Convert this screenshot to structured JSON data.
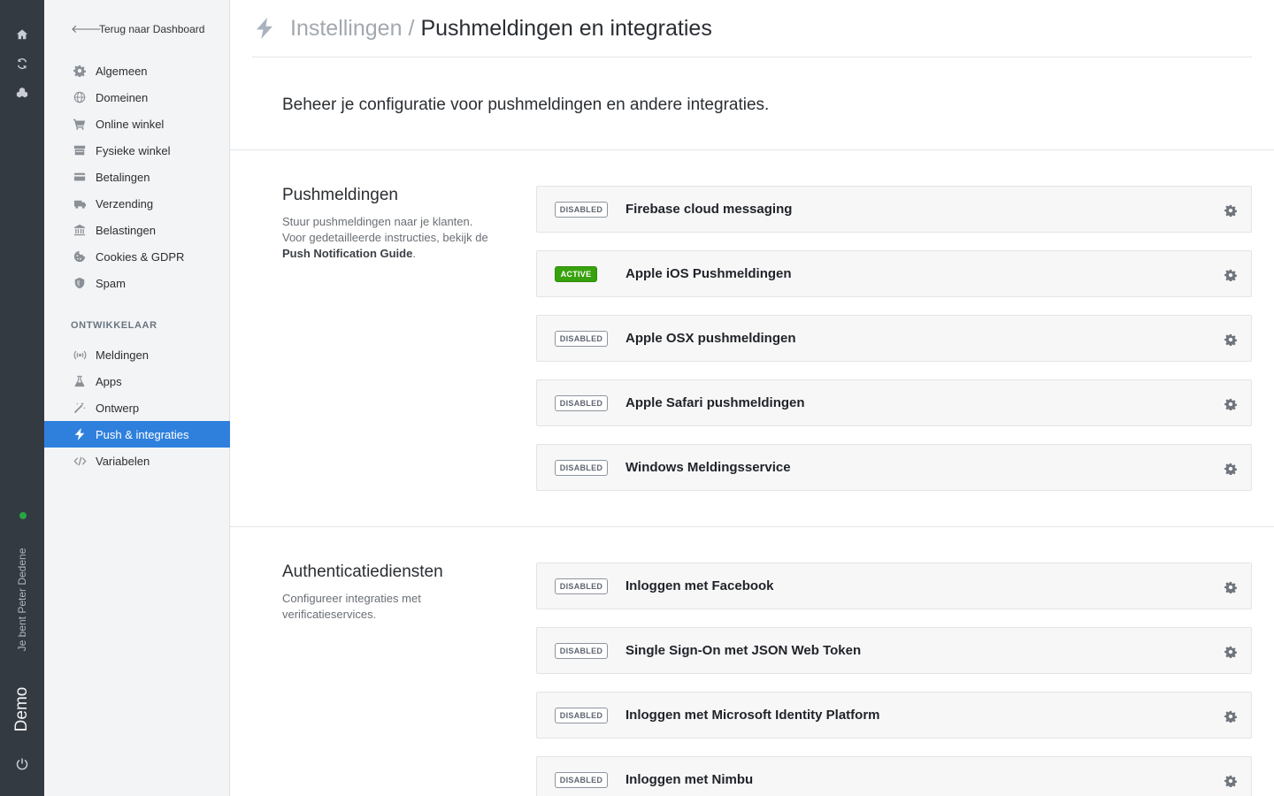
{
  "rail": {
    "user_label": "Je bent Peter Dedene",
    "demo_label": "Demo",
    "status_color": "#27a644"
  },
  "sidebar": {
    "back_label": "Terug naar Dashboard",
    "items": [
      {
        "label": "Algemeen",
        "icon": "gear-icon"
      },
      {
        "label": "Domeinen",
        "icon": "globe-icon"
      },
      {
        "label": "Online winkel",
        "icon": "cart-icon"
      },
      {
        "label": "Fysieke winkel",
        "icon": "store-icon"
      },
      {
        "label": "Betalingen",
        "icon": "credit-card-icon"
      },
      {
        "label": "Verzending",
        "icon": "truck-icon"
      },
      {
        "label": "Belastingen",
        "icon": "bank-icon"
      },
      {
        "label": "Cookies & GDPR",
        "icon": "cookie-icon"
      },
      {
        "label": "Spam",
        "icon": "shield-icon"
      }
    ],
    "dev_section_label": "ONTWIKKELAAR",
    "dev_items": [
      {
        "label": "Meldingen",
        "icon": "broadcast-icon"
      },
      {
        "label": "Apps",
        "icon": "flask-icon"
      },
      {
        "label": "Ontwerp",
        "icon": "magic-wand-icon"
      },
      {
        "label": "Push & integraties",
        "icon": "bolt-icon",
        "active": true
      },
      {
        "label": "Variabelen",
        "icon": "code-icon"
      }
    ]
  },
  "header": {
    "parent": "Instellingen",
    "separator": "/",
    "current": "Pushmeldingen en integraties"
  },
  "intro": "Beheer je configuratie voor pushmeldingen en andere integraties.",
  "sections": [
    {
      "title": "Pushmeldingen",
      "description_prefix": "Stuur pushmeldingen naar je klanten. Voor gedetailleerde instructies, bekijk de ",
      "description_link": "Push Notification Guide",
      "description_suffix": ".",
      "integrations": [
        {
          "status": "DISABLED",
          "name": "Firebase cloud messaging"
        },
        {
          "status": "ACTIVE",
          "name": "Apple iOS Pushmeldingen"
        },
        {
          "status": "DISABLED",
          "name": "Apple OSX pushmeldingen"
        },
        {
          "status": "DISABLED",
          "name": "Apple Safari pushmeldingen"
        },
        {
          "status": "DISABLED",
          "name": "Windows Meldingsservice"
        }
      ]
    },
    {
      "title": "Authenticatiediensten",
      "description": "Configureer integraties met verificatieservices.",
      "integrations": [
        {
          "status": "DISABLED",
          "name": "Inloggen met Facebook"
        },
        {
          "status": "DISABLED",
          "name": "Single Sign-On met JSON Web Token"
        },
        {
          "status": "DISABLED",
          "name": "Inloggen met Microsoft Identity Platform"
        },
        {
          "status": "DISABLED",
          "name": "Inloggen met Nimbu"
        }
      ]
    }
  ],
  "colors": {
    "accent": "#2f80dd",
    "active_badge": "#37a20c",
    "rail_bg": "#343a42"
  }
}
